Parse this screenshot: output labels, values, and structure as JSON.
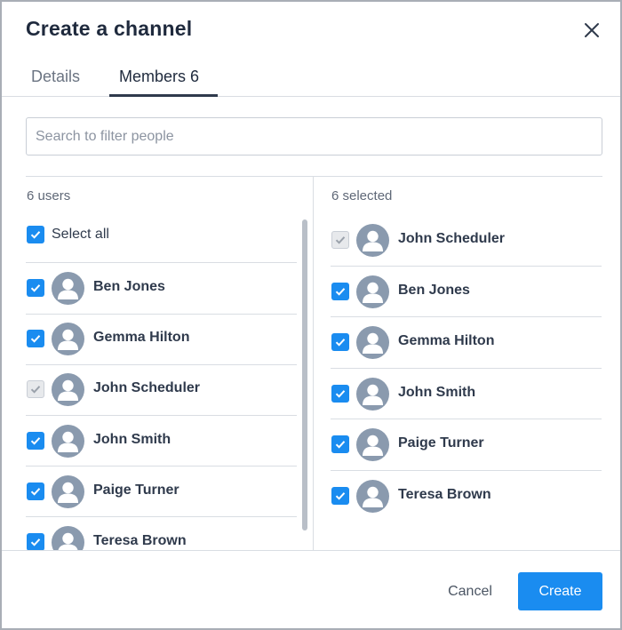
{
  "dialog": {
    "title": "Create a channel",
    "close_icon": "close-icon"
  },
  "tabs": [
    {
      "label": "Details",
      "active": false
    },
    {
      "label": "Members 6",
      "active": true
    }
  ],
  "search": {
    "placeholder": "Search to filter people",
    "value": ""
  },
  "left_panel": {
    "count_label": "6 users",
    "select_all": {
      "label": "Select all",
      "checked": true
    },
    "users": [
      {
        "name": "Ben Jones",
        "checked": true,
        "disabled": false
      },
      {
        "name": "Gemma Hilton",
        "checked": true,
        "disabled": false
      },
      {
        "name": "John Scheduler",
        "checked": true,
        "disabled": true
      },
      {
        "name": "John Smith",
        "checked": true,
        "disabled": false
      },
      {
        "name": "Paige Turner",
        "checked": true,
        "disabled": false
      },
      {
        "name": "Teresa Brown",
        "checked": true,
        "disabled": false
      }
    ]
  },
  "right_panel": {
    "count_label": "6 selected",
    "selected": [
      {
        "name": "John Scheduler",
        "checked": true,
        "disabled": true
      },
      {
        "name": "Ben Jones",
        "checked": true,
        "disabled": false
      },
      {
        "name": "Gemma Hilton",
        "checked": true,
        "disabled": false
      },
      {
        "name": "John Smith",
        "checked": true,
        "disabled": false
      },
      {
        "name": "Paige Turner",
        "checked": true,
        "disabled": false
      },
      {
        "name": "Teresa Brown",
        "checked": true,
        "disabled": false
      }
    ]
  },
  "footer": {
    "cancel_label": "Cancel",
    "create_label": "Create"
  },
  "colors": {
    "accent": "#1a8cf0",
    "avatar": "#8a9aae",
    "text": "#2f3a4c"
  }
}
